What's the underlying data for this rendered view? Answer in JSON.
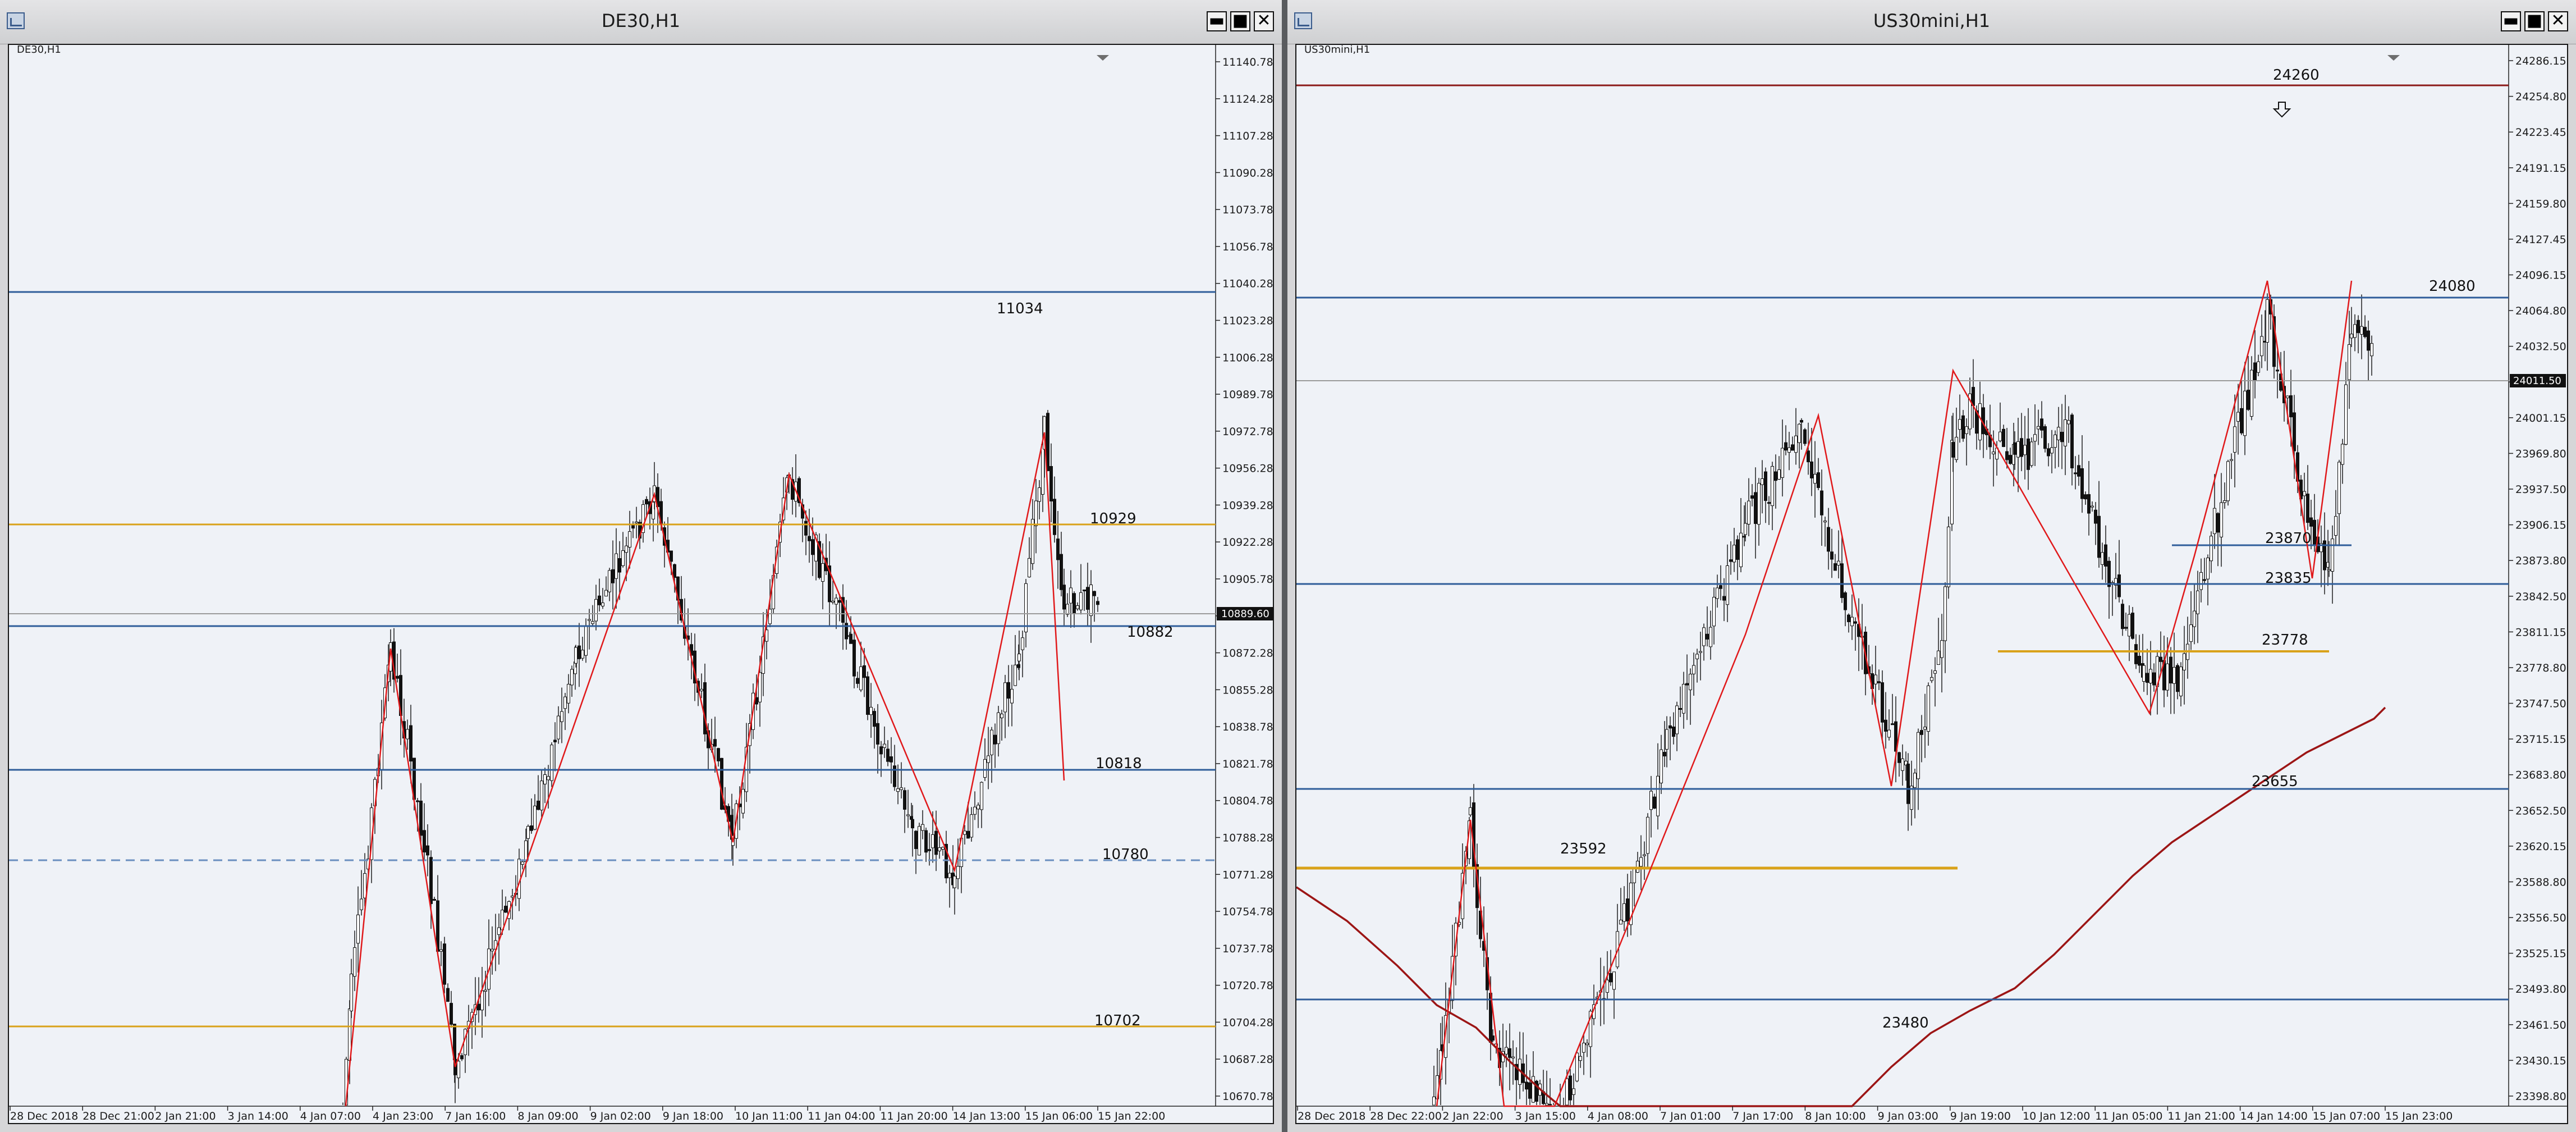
{
  "left": {
    "title": "DE30,H1",
    "symbol_label": "DE30,H1",
    "price_axis": [
      "11140.78",
      "11124.28",
      "11107.28",
      "11090.28",
      "11073.78",
      "11056.78",
      "11040.28",
      "11023.28",
      "11006.28",
      "10989.78",
      "10972.78",
      "10956.28",
      "10939.28",
      "10922.28",
      "10905.78",
      "10889.60",
      "10872.28",
      "10855.28",
      "10838.78",
      "10821.78",
      "10804.78",
      "10788.28",
      "10771.28",
      "10754.78",
      "10737.78",
      "10720.78",
      "10704.28",
      "10687.28",
      "10670.78"
    ],
    "current_price": "10889.60",
    "time_axis": [
      "28 Dec 2018",
      "28 Dec 21:00",
      "2 Jan 21:00",
      "3 Jan 14:00",
      "4 Jan 07:00",
      "4 Jan 23:00",
      "7 Jan 16:00",
      "8 Jan 09:00",
      "9 Jan 02:00",
      "9 Jan 18:00",
      "10 Jan 11:00",
      "11 Jan 04:00",
      "11 Jan 20:00",
      "14 Jan 13:00",
      "15 Jan 06:00",
      "15 Jan 22:00"
    ],
    "level_labels": [
      "11034",
      "10929",
      "10882",
      "10818",
      "10780",
      "10702"
    ],
    "colors": {
      "support_resistance_blue": "#2f5d9a",
      "key_level_orange": "#d9a21a",
      "zigzag_red": "#e0191b",
      "candle": "#111111"
    }
  },
  "right": {
    "title": "US30mini,H1",
    "symbol_label": "US30mini,H1",
    "price_axis": [
      "24286.15",
      "24254.80",
      "24223.45",
      "24191.15",
      "24159.80",
      "24127.45",
      "24096.15",
      "24064.80",
      "24032.50",
      "24011.50",
      "24001.15",
      "23969.80",
      "23937.50",
      "23906.15",
      "23873.80",
      "23842.50",
      "23811.15",
      "23778.80",
      "23747.50",
      "23715.15",
      "23683.80",
      "23652.50",
      "23620.15",
      "23588.80",
      "23556.50",
      "23525.15",
      "23493.80",
      "23461.50",
      "23430.15",
      "23398.80"
    ],
    "current_price": "24011.50",
    "time_axis": [
      "28 Dec 2018",
      "28 Dec 22:00",
      "2 Jan 22:00",
      "3 Jan 15:00",
      "4 Jan 08:00",
      "7 Jan 01:00",
      "7 Jan 17:00",
      "8 Jan 10:00",
      "9 Jan 03:00",
      "9 Jan 19:00",
      "10 Jan 12:00",
      "11 Jan 05:00",
      "11 Jan 21:00",
      "14 Jan 14:00",
      "15 Jan 07:00",
      "15 Jan 23:00"
    ],
    "level_labels": [
      "24260",
      "24080",
      "23870",
      "23835",
      "23778",
      "23655",
      "23592",
      "23480"
    ],
    "arrow_icon": "down-arrow-icon",
    "colors": {
      "resistance_darkred": "#8b1a1a",
      "support_resistance_blue": "#2f5d9a",
      "key_level_orange": "#d9a21a",
      "zigzag_red": "#e0191b",
      "moving_average": "#9c1515",
      "candle": "#111111"
    }
  },
  "window_controls": {
    "minimize": "▬",
    "maximize": "■",
    "close": "✕"
  }
}
